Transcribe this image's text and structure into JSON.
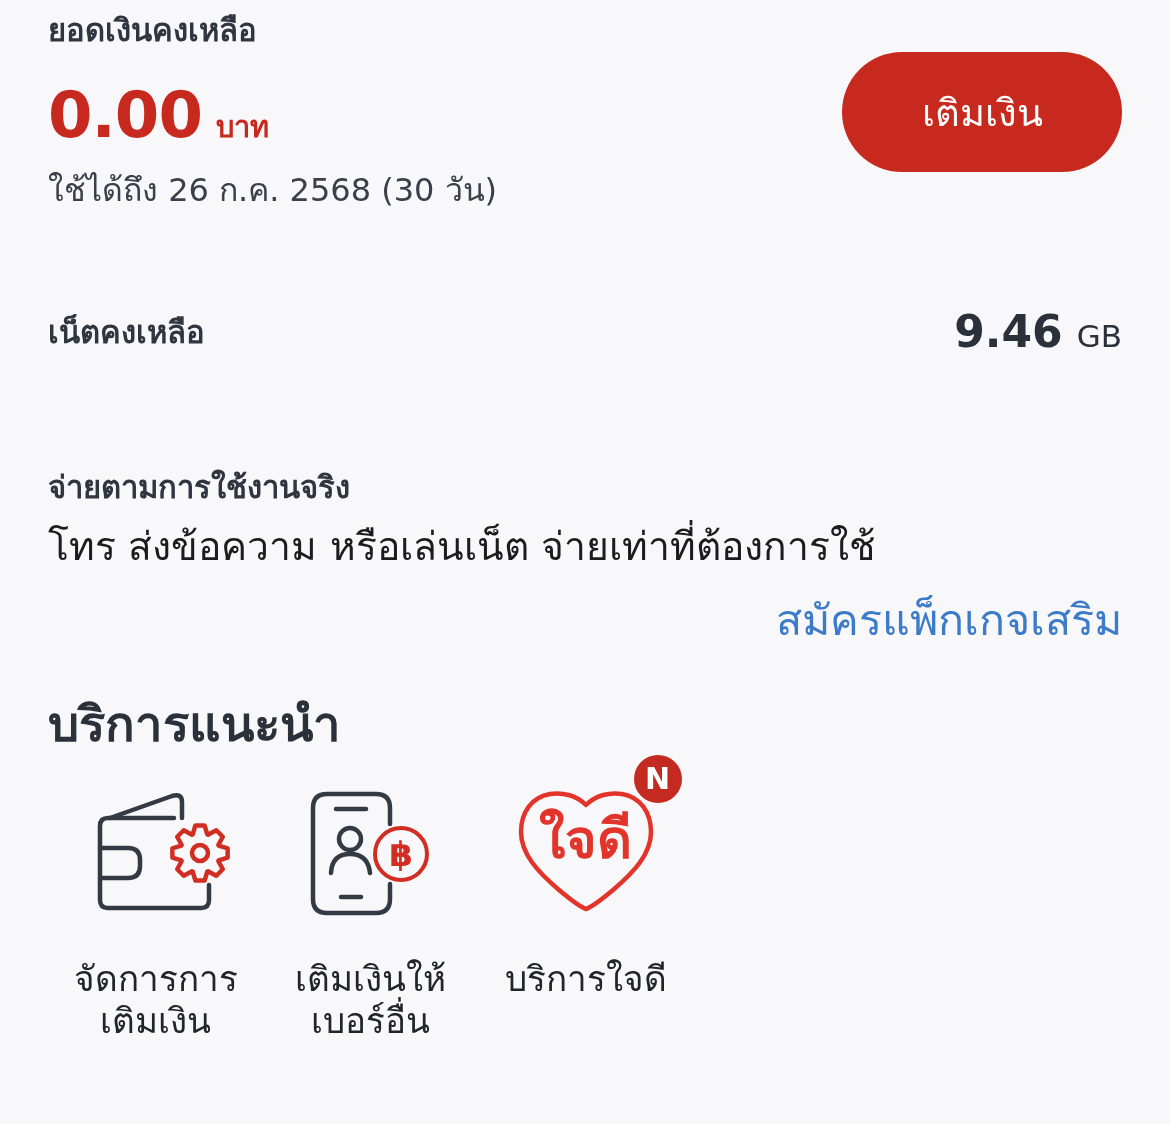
{
  "balance": {
    "label": "ยอดเงินคงเหลือ",
    "amount": "0.00",
    "currency": "บาท",
    "validity": "ใช้ได้ถึง 26 ก.ค. 2568 (30 วัน)",
    "top_up_button": "เติมเงิน"
  },
  "data_balance": {
    "label": "เน็ตคงเหลือ",
    "amount": "9.46",
    "unit": "GB"
  },
  "pay_per_use": {
    "title": "จ่ายตามการใช้งานจริง",
    "description": "โทร ส่งข้อความ หรือเล่นเน็ต จ่ายเท่าที่ต้องการใช้",
    "link": "สมัครแพ็กเกจเสริม"
  },
  "recommended": {
    "title": "บริการแนะนำ",
    "items": [
      {
        "kind": "wallet",
        "label_lines": [
          "จัดการการ",
          "เติมเงิน"
        ]
      },
      {
        "kind": "phone",
        "label_lines": [
          "เติมเงินให้",
          "เบอร์อื่น"
        ],
        "coin_symbol": "฿"
      },
      {
        "kind": "heart",
        "label_lines": [
          "บริการใจดี"
        ],
        "logo_text": "ใจดี",
        "badge": "N"
      }
    ]
  }
}
